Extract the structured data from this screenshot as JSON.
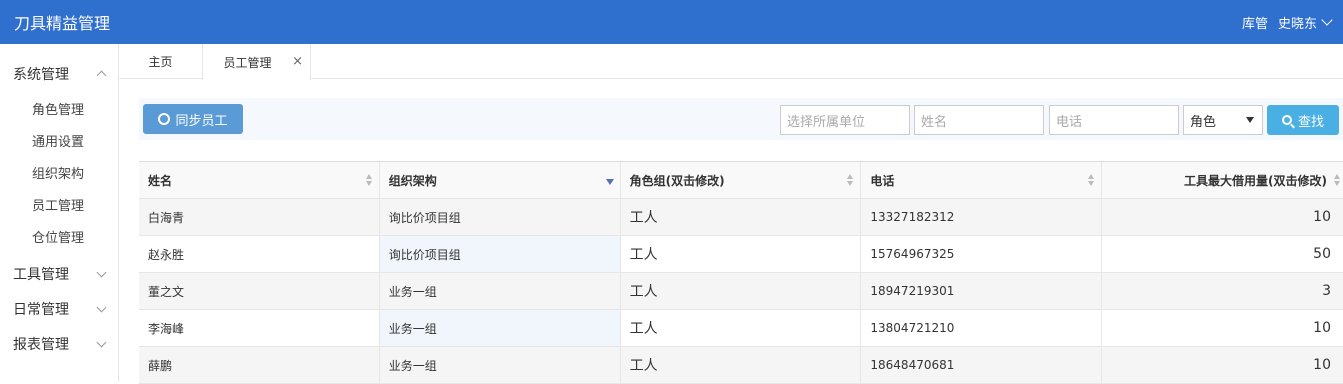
{
  "app": {
    "title": "刀具精益管理",
    "user_role": "库管",
    "user_name": "史晓东"
  },
  "sidebar": {
    "groups": [
      {
        "label": "系统管理",
        "expanded": true,
        "items": [
          {
            "label": "角色管理"
          },
          {
            "label": "通用设置"
          },
          {
            "label": "组织架构"
          },
          {
            "label": "员工管理"
          },
          {
            "label": "仓位管理"
          }
        ]
      },
      {
        "label": "工具管理",
        "expanded": false
      },
      {
        "label": "日常管理",
        "expanded": false
      },
      {
        "label": "报表管理",
        "expanded": false
      }
    ]
  },
  "tabs": [
    {
      "label": "主页"
    },
    {
      "label": "员工管理",
      "active": true,
      "close": "×"
    }
  ],
  "toolbar": {
    "sync_label": "同步员工",
    "unit_placeholder": "选择所属单位",
    "name_placeholder": "姓名",
    "phone_placeholder": "电话",
    "role_value": "角色",
    "search_label": "查找"
  },
  "table": {
    "columns": [
      "姓名",
      "组织架构",
      "角色组(双击修改)",
      "电话",
      "工具最大借用量(双击修改)"
    ],
    "rows": [
      {
        "name": "白海青",
        "org": "询比价项目组",
        "role": "工人",
        "phone": "13327182312",
        "max": "10"
      },
      {
        "name": "赵永胜",
        "org": "询比价项目组",
        "role": "工人",
        "phone": "15764967325",
        "max": "50"
      },
      {
        "name": "董之文",
        "org": "业务一组",
        "role": "工人",
        "phone": "18947219301",
        "max": "3"
      },
      {
        "name": "李海峰",
        "org": "业务一组",
        "role": "工人",
        "phone": "13804721210",
        "max": "10"
      },
      {
        "name": "薛鹏",
        "org": "业务一组",
        "role": "工人",
        "phone": "18648470681",
        "max": "10"
      }
    ]
  },
  "colors": {
    "header": "#2f6fce",
    "sync_button": "#5b9bd5",
    "search_button": "#4ab0e4"
  }
}
